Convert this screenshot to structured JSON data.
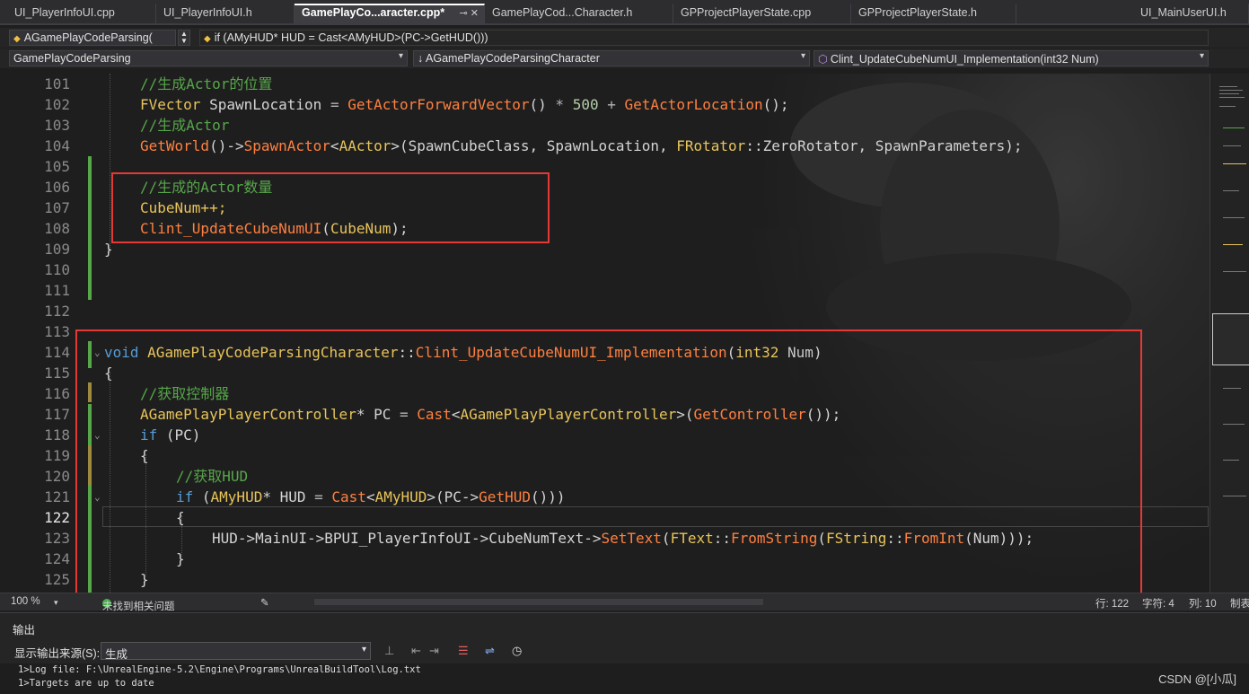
{
  "tabs": [
    {
      "label": "UI_PlayerInfoUI.cpp"
    },
    {
      "label": "UI_PlayerInfoUI.h"
    },
    {
      "label": "GamePlayCo...aracter.cpp*"
    },
    {
      "label": "GamePlayCod...Character.h"
    },
    {
      "label": "GPProjectPlayerState.cpp"
    },
    {
      "label": "GPProjectPlayerState.h"
    },
    {
      "label": "UI_MainUserUI.h"
    }
  ],
  "active_tab_icons": "⊸ ✕",
  "nav": {
    "scope_combo": "AGamePlayCodeParsing(",
    "breadcrumb": "if (AMyHUD* HUD = Cast<AMyHUD>(PC->GetHUD()))",
    "project_combo": "GamePlayCodeParsing",
    "class_combo": "AGamePlayCodeParsingCharacter",
    "member_combo": "Clint_UpdateCubeNumUI_Implementation(int32 Num)"
  },
  "code_lines": [
    {
      "n": "101",
      "text": "//生成Actor的位置"
    },
    {
      "n": "102",
      "text": "FVector SpawnLocation = GetActorForwardVector() * 500 + GetActorLocation();"
    },
    {
      "n": "103",
      "text": "//生成Actor"
    },
    {
      "n": "104",
      "text": "GetWorld()->SpawnActor<AActor>(SpawnCubeClass, SpawnLocation, FRotator::ZeroRotator, SpawnParameters);"
    },
    {
      "n": "105",
      "text": ""
    },
    {
      "n": "106",
      "text": "//生成的Actor数量"
    },
    {
      "n": "107",
      "text": "CubeNum++;"
    },
    {
      "n": "108",
      "text": "Clint_UpdateCubeNumUI(CubeNum);"
    },
    {
      "n": "109",
      "text": "}"
    },
    {
      "n": "110",
      "text": ""
    },
    {
      "n": "111",
      "text": ""
    },
    {
      "n": "112",
      "text": ""
    },
    {
      "n": "113",
      "text": ""
    },
    {
      "n": "114",
      "text": "void AGamePlayCodeParsingCharacter::Clint_UpdateCubeNumUI_Implementation(int32 Num)"
    },
    {
      "n": "115",
      "text": "{"
    },
    {
      "n": "116",
      "text": "//获取控制器"
    },
    {
      "n": "117",
      "text": "AGamePlayPlayerController* PC = Cast<AGamePlayPlayerController>(GetController());"
    },
    {
      "n": "118",
      "text": "if (PC)"
    },
    {
      "n": "119",
      "text": "{"
    },
    {
      "n": "120",
      "text": "//获取HUD"
    },
    {
      "n": "121",
      "text": "if (AMyHUD* HUD = Cast<AMyHUD>(PC->GetHUD()))"
    },
    {
      "n": "122",
      "text": "{"
    },
    {
      "n": "123",
      "text": "HUD->MainUI->BPUI_PlayerInfoUI->CubeNumText->SetText(FText::FromString(FString::FromInt(Num)));"
    },
    {
      "n": "124",
      "text": "}"
    },
    {
      "n": "125",
      "text": "}"
    }
  ],
  "status": {
    "zoom": "100 %",
    "issues": "未找到相关问题",
    "line": "行: 122",
    "char": "字符: 4",
    "col": "列: 10",
    "tabs": "制表"
  },
  "output": {
    "title": "输出",
    "source_label": "显示输出来源(S):",
    "source_value": "生成",
    "lines": [
      "1>Log file: F:\\UnrealEngine-5.2\\Engine\\Programs\\UnrealBuildTool\\Log.txt",
      "1>Targets are up to date"
    ]
  },
  "watermark": "CSDN @[小瓜]",
  "colors": {
    "comment": "#57a64a",
    "keyword": "#569cd6",
    "type": "#e8c45a",
    "function": "#ff8040",
    "highlight_box": "#e53935"
  }
}
